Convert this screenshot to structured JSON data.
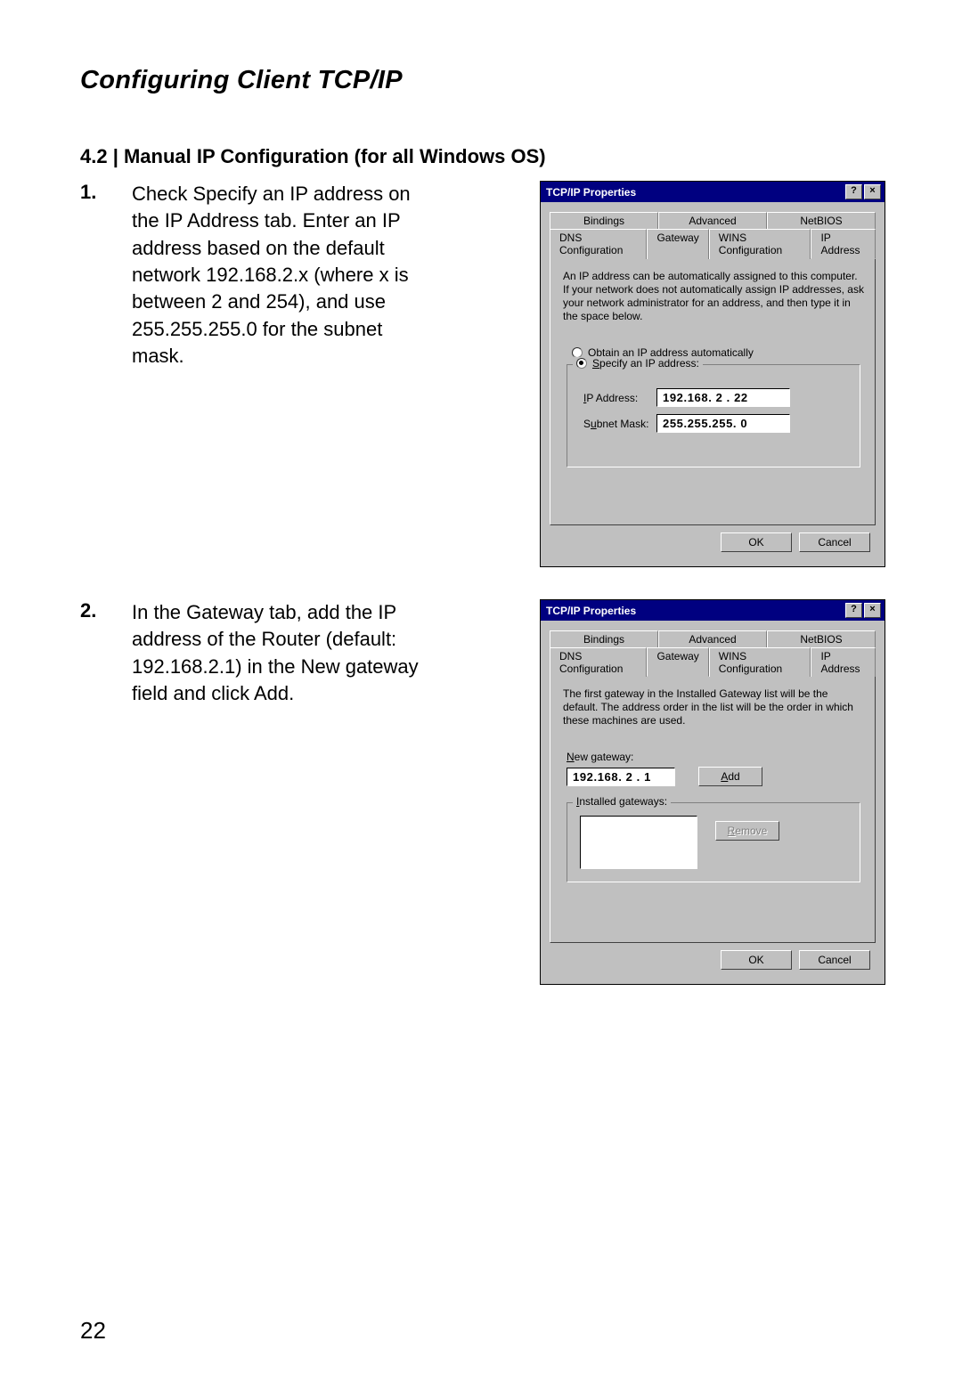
{
  "page": {
    "title": "Configuring Client TCP/IP",
    "number": "22"
  },
  "section": {
    "heading": "4.2 | Manual IP Configuration (for all Windows OS)"
  },
  "steps": [
    {
      "num": "1.",
      "text": "Check Specify an IP address on the IP Address tab. Enter an IP address based on the default network 192.168.2.x (where x is between 2 and 254), and use 255.255.255.0 for the subnet mask."
    },
    {
      "num": "2.",
      "text": "In the Gateway tab, add the IP address of the Router (default: 192.168.2.1) in the New gateway field and click Add."
    }
  ],
  "dlg_common": {
    "title": "TCP/IP Properties",
    "help_btn": "?",
    "close_btn": "×",
    "ok": "OK",
    "cancel": "Cancel",
    "tabs_row1": [
      "Bindings",
      "Advanced",
      "NetBIOS"
    ],
    "tabs_row2": [
      "DNS Configuration",
      "Gateway",
      "WINS Configuration",
      "IP Address"
    ]
  },
  "dlg_ip": {
    "help": "An IP address can be automatically assigned to this computer. If your network does not automatically assign IP addresses, ask your network administrator for an address, and then type it in the space below.",
    "radio_obtain": "Obtain an IP address automatically",
    "radio_specify": "Specify an IP address:",
    "label_ip": "IP Address:",
    "value_ip": "192.168. 2 . 22",
    "label_mask": "Subnet Mask:",
    "value_mask": "255.255.255. 0"
  },
  "dlg_gw": {
    "help": "The first gateway in the Installed Gateway list will be the default. The address order in the list will be the order in which these machines are used.",
    "label_new": "New gateway:",
    "value_new": "192.168. 2 . 1",
    "add": "Add",
    "label_installed": "Installed gateways:",
    "remove": "Remove"
  }
}
